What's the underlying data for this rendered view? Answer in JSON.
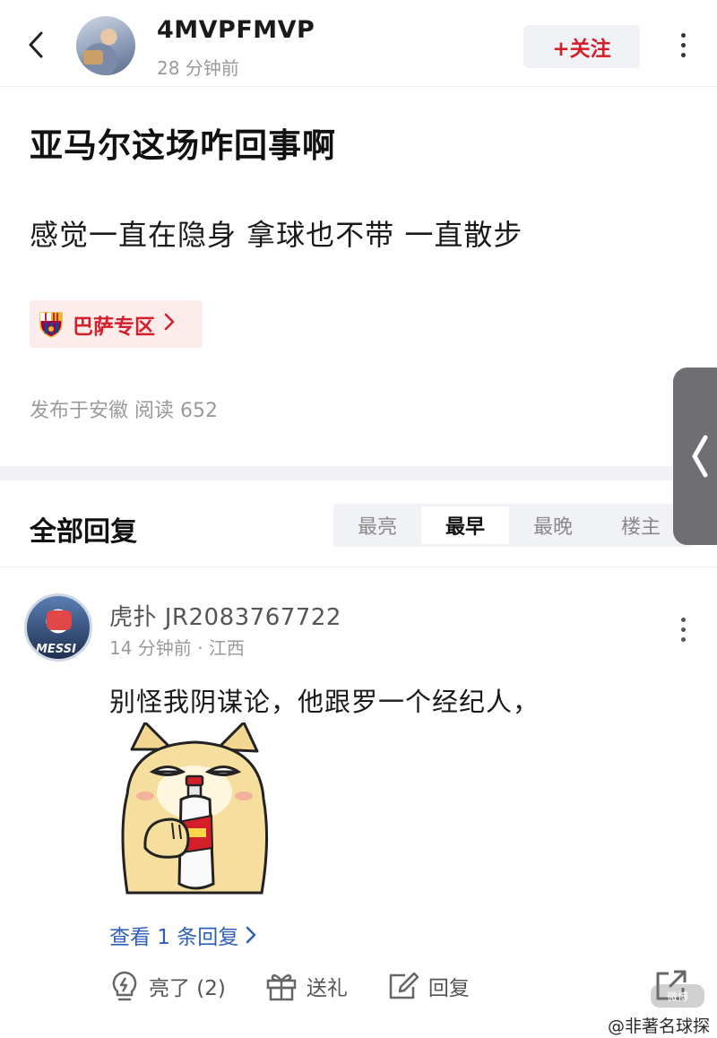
{
  "header": {
    "username": "4MVPFMVP",
    "time": "28 分钟前",
    "follow_label": "+关注"
  },
  "post": {
    "title": "亚马尔这场咋回事啊",
    "body": "感觉一直在隐身 拿球也不带 一直散步",
    "tag": "巴萨专区",
    "meta": "发布于安徽  阅读 652"
  },
  "replies": {
    "title": "全部回复",
    "sort_options": [
      "最亮",
      "最早",
      "最晚",
      "楼主"
    ],
    "active_sort": "最早"
  },
  "comment": {
    "user": "虎扑 JR2083767722",
    "time_location": "14 分钟前 · 江西",
    "text": "别怪我阴谋论，他跟罗一个经纪人，",
    "avatar_badge": "MESSI",
    "view_replies": "查看 1 条回复",
    "actions": {
      "like": "亮了 (2)",
      "gift": "送礼",
      "reply": "回复"
    }
  },
  "watermark": "@非著名球探",
  "watermark_logo": "微博",
  "colors": {
    "accent_red": "#d41f2b",
    "link_blue": "#2f5fb8",
    "muted_gray": "#9a9a9a"
  },
  "icons": {
    "back": "chevron-left-icon",
    "more": "more-vertical-icon",
    "tag_logo": "barcelona-crest-icon",
    "like": "lightbulb-icon",
    "gift": "gift-icon",
    "reply": "edit-reply-icon",
    "share": "share-icon"
  }
}
